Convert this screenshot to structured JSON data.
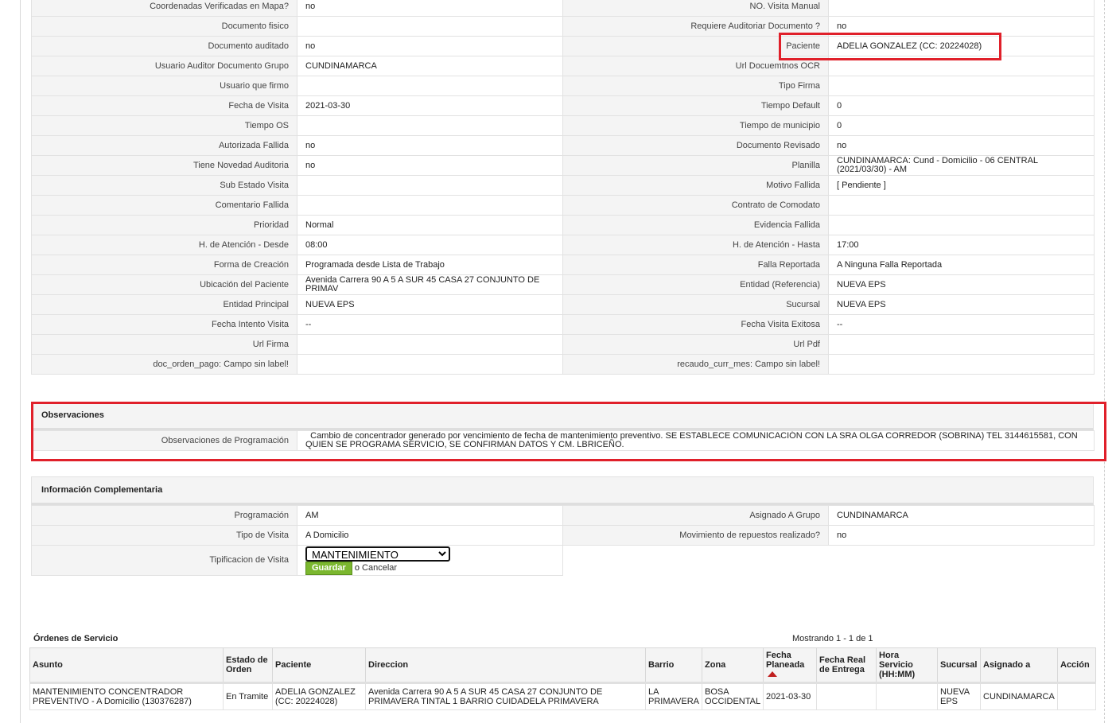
{
  "details": {
    "rows": [
      {
        "l1": "Coordenadas Verificadas en Mapa?",
        "v1": "no",
        "l2": "NO. Visita Manual",
        "v2": ""
      },
      {
        "l1": "Documento fisico",
        "v1": "",
        "l2": "Requiere Auditoriar Documento ?",
        "v2": "no"
      },
      {
        "l1": "Documento auditado",
        "v1": "no",
        "l2": "Paciente",
        "v2": "ADELIA GONZALEZ (CC: 20224028)"
      },
      {
        "l1": "Usuario Auditor Documento Grupo",
        "v1": "CUNDINAMARCA",
        "l2": "Url Docuemtnos OCR",
        "v2": ""
      },
      {
        "l1": "Usuario que firmo",
        "v1": "",
        "l2": "Tipo Firma",
        "v2": ""
      },
      {
        "l1": "Fecha de Visita",
        "v1": "2021-03-30",
        "l2": "Tiempo Default",
        "v2": "0"
      },
      {
        "l1": "Tiempo OS",
        "v1": "",
        "l2": "Tiempo de municipio",
        "v2": "0"
      },
      {
        "l1": "Autorizada Fallida",
        "v1": "no",
        "l2": "Documento Revisado",
        "v2": "no"
      },
      {
        "l1": "Tiene Novedad Auditoria",
        "v1": "no",
        "l2": "Planilla",
        "v2": "CUNDINAMARCA: Cund - Domicilio - 06 CENTRAL (2021/03/30) - AM"
      },
      {
        "l1": "Sub Estado Visita",
        "v1": "",
        "l2": "Motivo Fallida",
        "v2": "[ Pendiente ]"
      },
      {
        "l1": "Comentario Fallida",
        "v1": "",
        "l2": "Contrato de Comodato",
        "v2": ""
      },
      {
        "l1": "Prioridad",
        "v1": "Normal",
        "l2": "Evidencia Fallida",
        "v2": ""
      },
      {
        "l1": "H. de Atención - Desde",
        "v1": "08:00",
        "l2": "H. de Atención - Hasta",
        "v2": "17:00"
      },
      {
        "l1": "Forma de Creación",
        "v1": "Programada desde Lista de Trabajo",
        "l2": "Falla Reportada",
        "v2": "A Ninguna Falla Reportada"
      },
      {
        "l1": "Ubicación del Paciente",
        "v1": "Avenida Carrera 90 A 5 A SUR 45 CASA 27 CONJUNTO DE PRIMAV",
        "l2": "Entidad (Referencia)",
        "v2": "NUEVA EPS"
      },
      {
        "l1": "Entidad Principal",
        "v1": "NUEVA EPS",
        "l2": "Sucursal",
        "v2": "NUEVA EPS"
      },
      {
        "l1": "Fecha Intento Visita",
        "v1": "--",
        "l2": "Fecha Visita Exitosa",
        "v2": "--"
      },
      {
        "l1": "Url Firma",
        "v1": "",
        "l2": "Url Pdf",
        "v2": ""
      },
      {
        "l1": "doc_orden_pago: Campo sin label!",
        "v1": "",
        "l2": "recaudo_curr_mes: Campo sin label!",
        "v2": ""
      }
    ]
  },
  "observaciones": {
    "title": "Observaciones",
    "label": "Observaciones de Programación",
    "value": "  Cambio de concentrador generado por vencimiento de fecha de mantenimiento preventivo. SE ESTABLECE COMUNICACIÓN CON LA SRA OLGA CORREDOR (SOBRINA) TEL 3144615581, CON QUIEN SE PROGRAMA SERVICIO, SE CONFIRMAN DATOS Y CM. LBRICEÑO."
  },
  "info": {
    "title": "Información Complementaria",
    "programacion_label": "Programación",
    "programacion": "AM",
    "asignado_label": "Asignado A Grupo",
    "asignado": "CUNDINAMARCA",
    "tipo_label": "Tipo de Visita",
    "tipo": "A Domicilio",
    "movimiento_label": "Movimiento de repuestos realizado?",
    "movimiento": "no",
    "tipificacion_label": "Tipificacion de Visita",
    "tipificacion_selected": "MANTENIMIENTO",
    "save_label": "Guardar",
    "or_text": "o",
    "cancel_label": "Cancelar"
  },
  "orders": {
    "title": "Órdenes de Servicio",
    "count": "Mostrando 1 - 1 de 1",
    "headers": {
      "asunto": "Asunto",
      "estado": "Estado de Orden",
      "paciente": "Paciente",
      "direccion": "Direccion",
      "barrio": "Barrio",
      "zona": "Zona",
      "fecha_planeada": "Fecha Planeada",
      "fecha_real": "Fecha Real de Entrega",
      "hora": "Hora Servicio (HH:MM)",
      "sucursal": "Sucursal",
      "asignado": "Asignado a",
      "accion": "Acción"
    },
    "row": {
      "asunto": "MANTENIMIENTO CONCENTRADOR PREVENTIVO - A Domicilio (130376287)",
      "estado": "En Tramite",
      "paciente": "ADELIA GONZALEZ (CC: 20224028)",
      "direccion": "Avenida Carrera 90 A 5 A SUR 45 CASA 27 CONJUNTO DE PRIMAVERA TINTAL 1 BARRIO CUIDADELA PRIMAVERA",
      "barrio": "LA PRIMAVERA",
      "zona": "BOSA OCCIDENTAL",
      "fecha_planeada": "2021-03-30",
      "fecha_real": "",
      "hora": "",
      "sucursal": "NUEVA EPS",
      "asignado": "CUNDINAMARCA",
      "accion": ""
    }
  },
  "colors": {
    "highlight": "#e0202a",
    "save_button": "#7bb72f",
    "label_bg": "#f4f4f4"
  }
}
